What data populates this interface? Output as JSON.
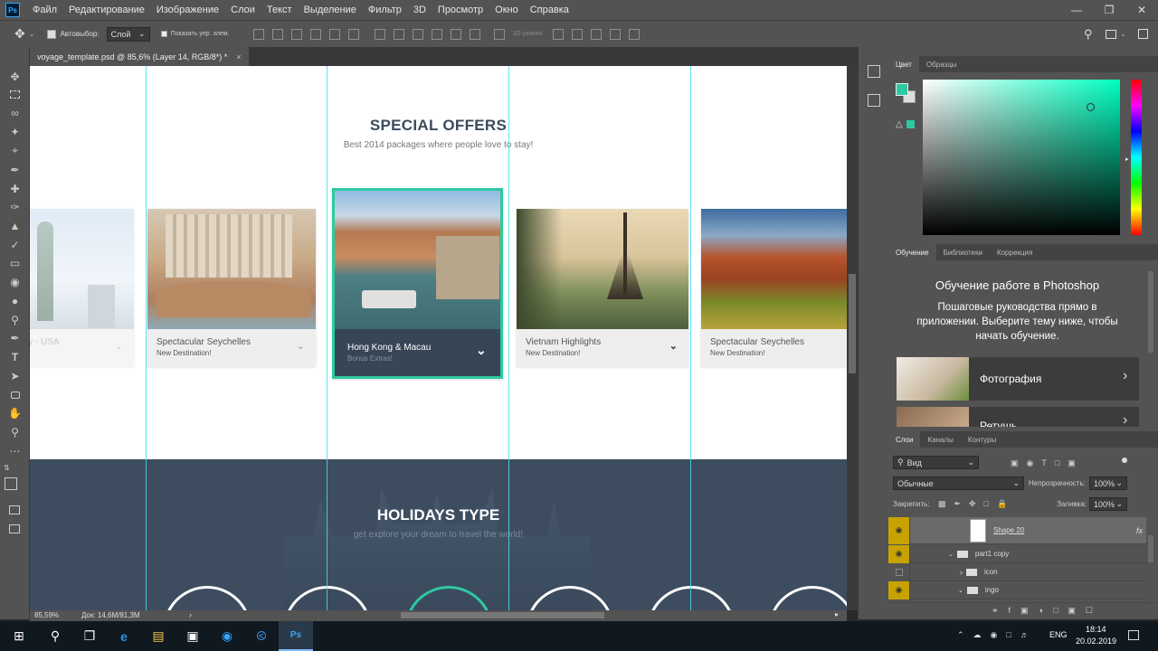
{
  "app": {
    "logo": "Ps"
  },
  "menu": [
    "Файл",
    "Редактирование",
    "Изображение",
    "Слои",
    "Текст",
    "Выделение",
    "Фильтр",
    "3D",
    "Просмотр",
    "Окно",
    "Справка"
  ],
  "options": {
    "autoselect_label": "Автовыбор:",
    "autoselect_value": "Слой",
    "show_transform_label": "Показать упр. элем.",
    "mode3d_label": "3D-режим:"
  },
  "doc_tab": {
    "title": "voyage_template.psd @ 85,6% (Layer 14, RGB/8*) *",
    "close": "×"
  },
  "page": {
    "section_title": "SPECIAL OFFERS",
    "section_subtitle": "Best 2014 packages where people love to stay!",
    "cards": [
      {
        "title": "rty - USA",
        "sub": "n!"
      },
      {
        "title": "Spectacular Seychelles",
        "sub": "New Destination!"
      },
      {
        "title": "Hong Kong & Macau",
        "sub": "Bonus Extras!"
      },
      {
        "title": "Vietnam Highlights",
        "sub": "New Destination!"
      },
      {
        "title": "Spectacular Seychelles",
        "sub": "New Destination!"
      }
    ],
    "holidays_title": "HOLIDAYS TYPE",
    "holidays_subtitle": "get explore your dream to travel the world!"
  },
  "status": {
    "zoom": "85,59%",
    "doc": "Док: 14,6M/81,3M"
  },
  "color_panel": {
    "tabs": [
      "Цвет",
      "Образцы"
    ],
    "fg": "#2ec9a0",
    "bg": "#dddddd"
  },
  "learn_panel": {
    "tabs": [
      "Обучение",
      "Библиотеки",
      "Коррекция"
    ],
    "heading": "Обучение работе в Photoshop",
    "body": "Пошаговые руководства прямо в приложении. Выберите тему ниже, чтобы начать обучение.",
    "items": [
      "Фотография",
      "Ретушь"
    ]
  },
  "layers_panel": {
    "tabs": [
      "Слои",
      "Каналы",
      "Контуры"
    ],
    "filter": "Вид",
    "blend": "Обычные",
    "opacity_label": "Непрозрачность:",
    "opacity": "100%",
    "lock_label": "Закрепить:",
    "fill_label": "Заливка:",
    "fill": "100%",
    "layers": [
      {
        "name": "Shape 20",
        "fx": "fx"
      },
      {
        "name": "part1 copy"
      },
      {
        "name": "icon"
      },
      {
        "name": "ingo"
      }
    ]
  },
  "taskbar": {
    "lang": "ENG",
    "time": "18:14",
    "date": "20.02.2019"
  },
  "colors": {
    "accent": "#2ec9a0",
    "guide": "#3fe0f0",
    "dark_band": "#3d4d5f",
    "card_dark": "#364657"
  }
}
